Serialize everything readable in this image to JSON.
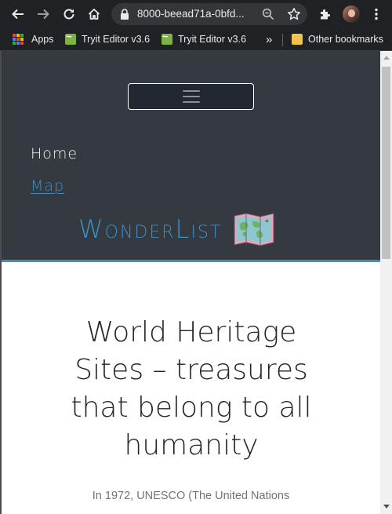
{
  "browser": {
    "url": "8000-beead71a-0bfd...",
    "icons": {
      "back": "arrow-left-icon",
      "forward": "arrow-right-icon",
      "reload": "reload-icon",
      "home": "home-icon",
      "lock": "lock-icon",
      "zoom": "zoom-icon",
      "bookmark": "star-icon",
      "extensions": "puzzle-icon",
      "menu": "kebab-menu-icon"
    },
    "bookmarks": [
      {
        "label": "Apps"
      },
      {
        "label": "Tryit Editor v3.6"
      },
      {
        "label": "Tryit Editor v3.6"
      }
    ],
    "bookmarks_overflow": "»",
    "other_bookmarks": "Other bookmarks"
  },
  "page": {
    "nav": {
      "links": [
        {
          "label": "Home"
        },
        {
          "label": "Map"
        }
      ],
      "brand": "WonderList"
    },
    "hero": {
      "title": "World Heritage Sites – treasures that belong to all humanity",
      "intro": "In 1972, UNESCO (The United Nations"
    }
  },
  "colors": {
    "chrome_bg": "#202124",
    "omnibox_bg": "#35363a",
    "navbar_bg": "#343a40",
    "accent_blue": "#3b8fc7",
    "heading_text": "#212529",
    "muted_text": "#6c757d"
  }
}
